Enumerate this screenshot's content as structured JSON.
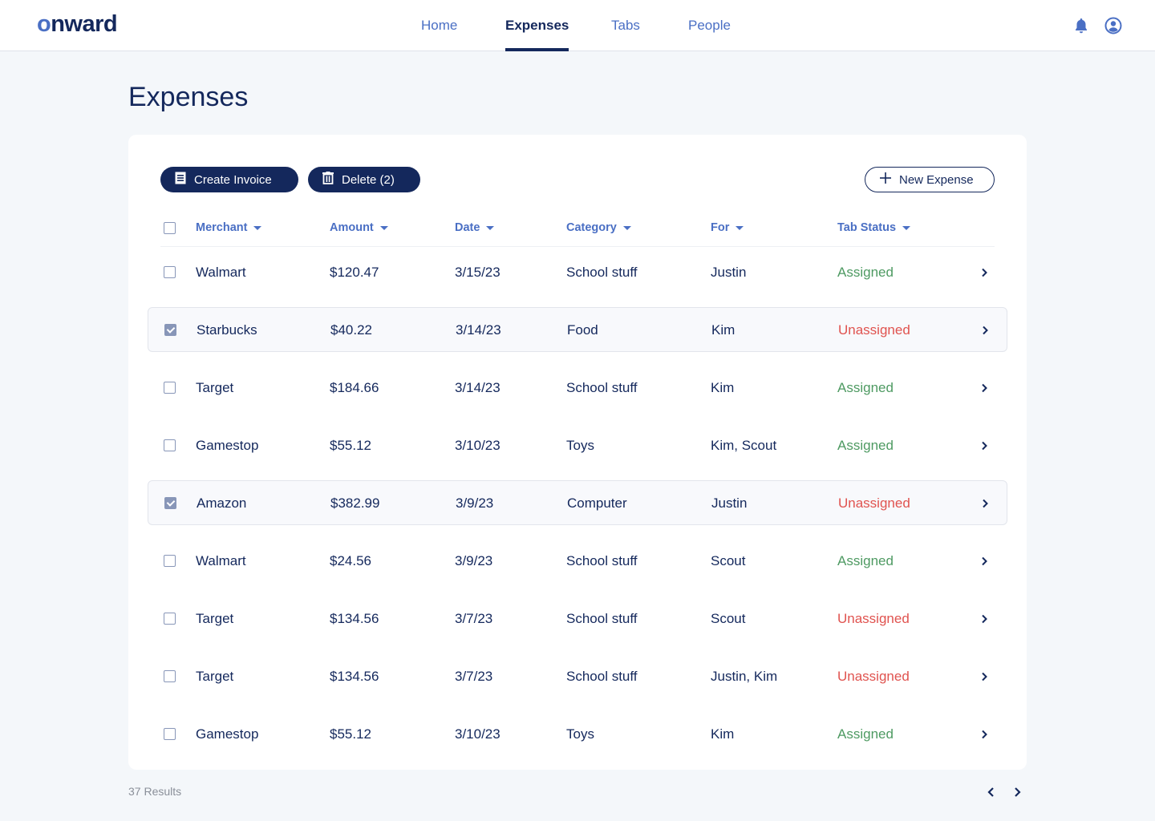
{
  "app": {
    "logo": "onward",
    "logo_first_letter": "o",
    "logo_rest": "nward"
  },
  "nav": {
    "items": [
      {
        "label": "Home",
        "active": false
      },
      {
        "label": "Expenses",
        "active": true
      },
      {
        "label": "Tabs",
        "active": false
      },
      {
        "label": "People",
        "active": false
      }
    ],
    "icons": {
      "notifications": "bell-icon",
      "account": "user-circle-icon"
    }
  },
  "page": {
    "title": "Expenses"
  },
  "toolbar": {
    "create_invoice_label": "Create Invoice",
    "create_invoice_icon": "invoice-icon",
    "delete_label": "Delete (2)",
    "delete_icon": "trash-icon",
    "new_expense_label": "New Expense",
    "new_expense_icon": "plus-icon"
  },
  "table": {
    "columns": [
      {
        "label": "Merchant",
        "sortable": true
      },
      {
        "label": "Amount",
        "sortable": true
      },
      {
        "label": "Date",
        "sortable": true
      },
      {
        "label": "Category",
        "sortable": true
      },
      {
        "label": "For",
        "sortable": true
      },
      {
        "label": "Tab Status",
        "sortable": true
      }
    ],
    "select_all_checked": false,
    "rows": [
      {
        "merchant": "Walmart",
        "amount": "$120.47",
        "date": "3/15/23",
        "category": "School stuff",
        "for": "Justin",
        "status": "Assigned",
        "selected": false
      },
      {
        "merchant": "Starbucks",
        "amount": "$40.22",
        "date": "3/14/23",
        "category": "Food",
        "for": "Kim",
        "status": "Unassigned",
        "selected": true
      },
      {
        "merchant": "Target",
        "amount": "$184.66",
        "date": "3/14/23",
        "category": "School stuff",
        "for": "Kim",
        "status": "Assigned",
        "selected": false
      },
      {
        "merchant": "Gamestop",
        "amount": "$55.12",
        "date": "3/10/23",
        "category": "Toys",
        "for": "Kim, Scout",
        "status": "Assigned",
        "selected": false
      },
      {
        "merchant": "Amazon",
        "amount": "$382.99",
        "date": "3/9/23",
        "category": "Computer",
        "for": "Justin",
        "status": "Unassigned",
        "selected": true
      },
      {
        "merchant": "Walmart",
        "amount": "$24.56",
        "date": "3/9/23",
        "category": "School stuff",
        "for": "Scout",
        "status": "Assigned",
        "selected": false
      },
      {
        "merchant": "Target",
        "amount": "$134.56",
        "date": "3/7/23",
        "category": "School stuff",
        "for": "Scout",
        "status": "Unassigned",
        "selected": false
      },
      {
        "merchant": "Target",
        "amount": "$134.56",
        "date": "3/7/23",
        "category": "School stuff",
        "for": "Justin, Kim",
        "status": "Unassigned",
        "selected": false
      },
      {
        "merchant": "Gamestop",
        "amount": "$55.12",
        "date": "3/10/23",
        "category": "Toys",
        "for": "Kim",
        "status": "Assigned",
        "selected": false
      }
    ]
  },
  "footer": {
    "results_label": "37 Results",
    "prev_icon": "chevron-left-icon",
    "next_icon": "chevron-right-icon"
  },
  "colors": {
    "primary": "#14285c",
    "accent": "#4a6fc4",
    "assigned": "#4e9a62",
    "unassigned": "#e0534f",
    "background": "#f4f7fa"
  }
}
